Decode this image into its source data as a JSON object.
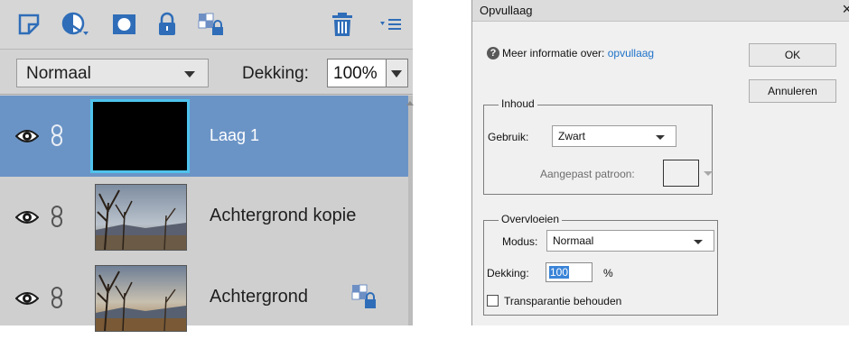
{
  "layers_panel": {
    "toolbar": {
      "icons": [
        "new-layer-icon",
        "adjustment-layer-icon",
        "mask-icon",
        "lock-icon",
        "lock-transparency-icon",
        "trash-icon",
        "panel-menu-icon"
      ]
    },
    "blend_mode": "Normaal",
    "opacity_label": "Dekking:",
    "opacity_value": "100%",
    "layers": [
      {
        "name": "Laag 1",
        "selected": true,
        "visible": true,
        "locked": false
      },
      {
        "name": "Achtergrond kopie",
        "selected": false,
        "visible": true,
        "locked": false
      },
      {
        "name": "Achtergrond",
        "selected": false,
        "visible": true,
        "locked": true
      }
    ]
  },
  "dialog": {
    "title": "Opvullaag",
    "close": "×",
    "info_prefix": "Meer informatie over:",
    "info_link": "opvullaag",
    "ok_label": "OK",
    "cancel_label": "Annuleren",
    "content_group": {
      "label": "Inhoud",
      "use_label": "Gebruik:",
      "use_value": "Zwart",
      "pattern_label": "Aangepast patroon:"
    },
    "blend_group": {
      "label": "Overvloeien",
      "mode_label": "Modus:",
      "mode_value": "Normaal",
      "opacity_label": "Dekking:",
      "opacity_value": "100",
      "percent": "%",
      "preserve_label": "Transparantie behouden",
      "preserve_checked": false
    }
  },
  "colors": {
    "selection": "#6b94c6",
    "thumb_border": "#4fc3ec",
    "icon_blue": "#2f6db8",
    "link": "#1f72c9"
  }
}
